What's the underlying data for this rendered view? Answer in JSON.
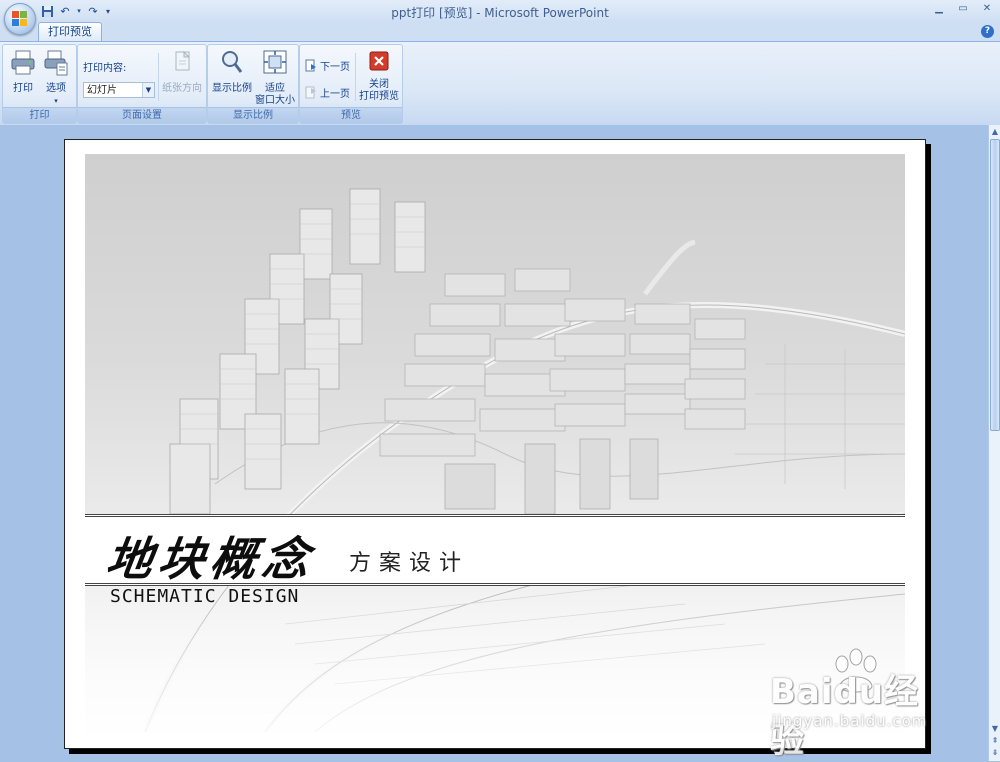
{
  "window": {
    "title": "ppt打印 [预览] - Microsoft PowerPoint",
    "minimize_glyph": "▁",
    "restore_glyph": "▭",
    "close_glyph": "✕"
  },
  "qat": {
    "save": "💾",
    "undo": "↶",
    "redo": "↷",
    "more": "▾"
  },
  "tabs": {
    "active": "打印预览",
    "help": "?"
  },
  "ribbon": {
    "print_group": {
      "label": "打印",
      "print_button": "打印",
      "options_button": "选项",
      "options_arrow": "▾"
    },
    "page_setup_group": {
      "label": "页面设置",
      "print_what_label": "打印内容:",
      "print_what_value": "幻灯片",
      "orientation_button": "纸张方向"
    },
    "zoom_group": {
      "label": "显示比例",
      "zoom_button": "显示比例",
      "fit_button_line1": "适应",
      "fit_button_line2": "窗口大小"
    },
    "preview_group": {
      "label": "预览",
      "next_page": "下一页",
      "prev_page": "上一页",
      "close_line1": "关闭",
      "close_line2": "打印预览"
    }
  },
  "slide": {
    "title": "地块概念",
    "subtitle": "方案设计",
    "english_title": "SCHEMATIC DESIGN"
  },
  "watermark": {
    "main": "Baidu经验",
    "sub": "jingyan.baidu.com"
  },
  "colors": {
    "ribbon_text": "#15428b",
    "workspace": "#a5c1e6",
    "close_red": "#d23c2c"
  }
}
